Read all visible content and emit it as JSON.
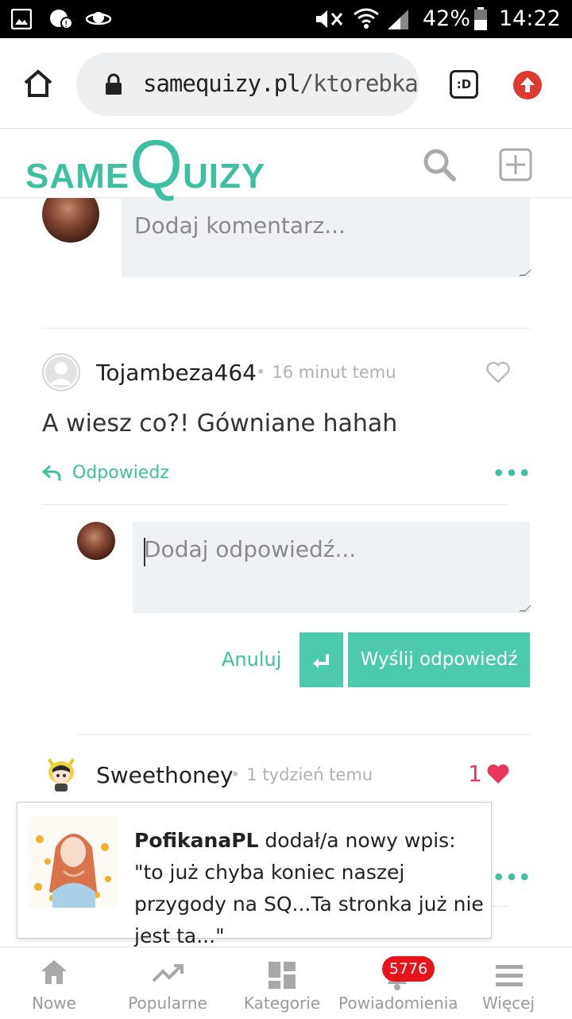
{
  "status_bar": {
    "battery_percent": "42%",
    "time": "14:22"
  },
  "browser": {
    "url_domain": "samequizy.pl",
    "url_path": "/ktorebka-",
    "tab_switcher_label": ":D"
  },
  "site": {
    "logo_same": "SAME",
    "logo_q": "Q",
    "logo_uizy": "UIZY"
  },
  "comment_box": {
    "placeholder": "Dodaj komentarz..."
  },
  "comments": [
    {
      "username": "Tojambeza464",
      "time": "16 minut temu",
      "text": "A wiesz co?! Gówniane hahah",
      "reply_label": "Odpowiedz"
    },
    {
      "username": "Sweethoney",
      "time": "1 tydzień temu",
      "likes": "1"
    }
  ],
  "reply_form": {
    "placeholder": "Dodaj odpowiedź...",
    "cancel_label": "Anuluj",
    "submit_label": "Wyślij odpowiedź"
  },
  "toast": {
    "user": "PofikanaPL",
    "message": " dodał/a nowy wpis: \"to już chyba koniec naszej przygody na SQ...Ta stronka już nie jest ta...\""
  },
  "bottom_nav": {
    "items": [
      {
        "label": "Nowe",
        "icon": "home-icon"
      },
      {
        "label": "Popularne",
        "icon": "trending-icon"
      },
      {
        "label": "Kategorie",
        "icon": "grid-icon"
      },
      {
        "label": "Powiadomienia",
        "icon": "bell-icon"
      },
      {
        "label": "Więcej",
        "icon": "menu-icon"
      }
    ],
    "notification_count": "5776"
  },
  "colors": {
    "accent": "#3dbfa2",
    "like": "#e8365d",
    "badge": "#e8141c"
  }
}
